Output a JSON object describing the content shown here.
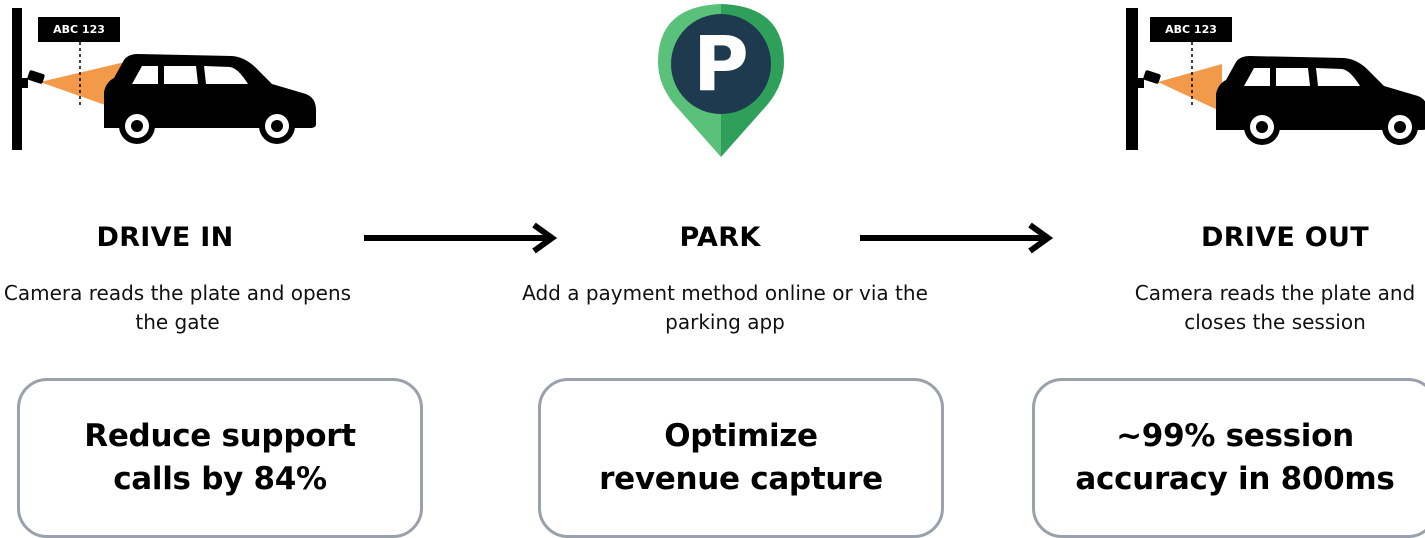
{
  "steps": [
    {
      "title": "DRIVE IN",
      "description": "Camera reads the plate and opens the gate",
      "illustration_icon": "camera-car-gate-icon",
      "plate_text": "ABC 123"
    },
    {
      "title": "PARK",
      "description": "Add a payment method online or via the parking app",
      "illustration_icon": "parking-pin-icon",
      "pin_letter": "P"
    },
    {
      "title": "DRIVE OUT",
      "description": "Camera reads the plate and closes the session",
      "illustration_icon": "camera-car-gate-icon",
      "plate_text": "ABC 123"
    }
  ],
  "benefits": [
    {
      "text": "Reduce support\ncalls by 84%"
    },
    {
      "text": "Optimize\nrevenue capture"
    },
    {
      "text": "~99% session\naccuracy in 800ms"
    }
  ],
  "colors": {
    "camera_beam": "#f39a4a",
    "pin_green_light": "#59c17a",
    "pin_green_dark": "#2ea05a",
    "pin_circle": "#1d3a4f",
    "card_border": "#9aa1ab"
  }
}
